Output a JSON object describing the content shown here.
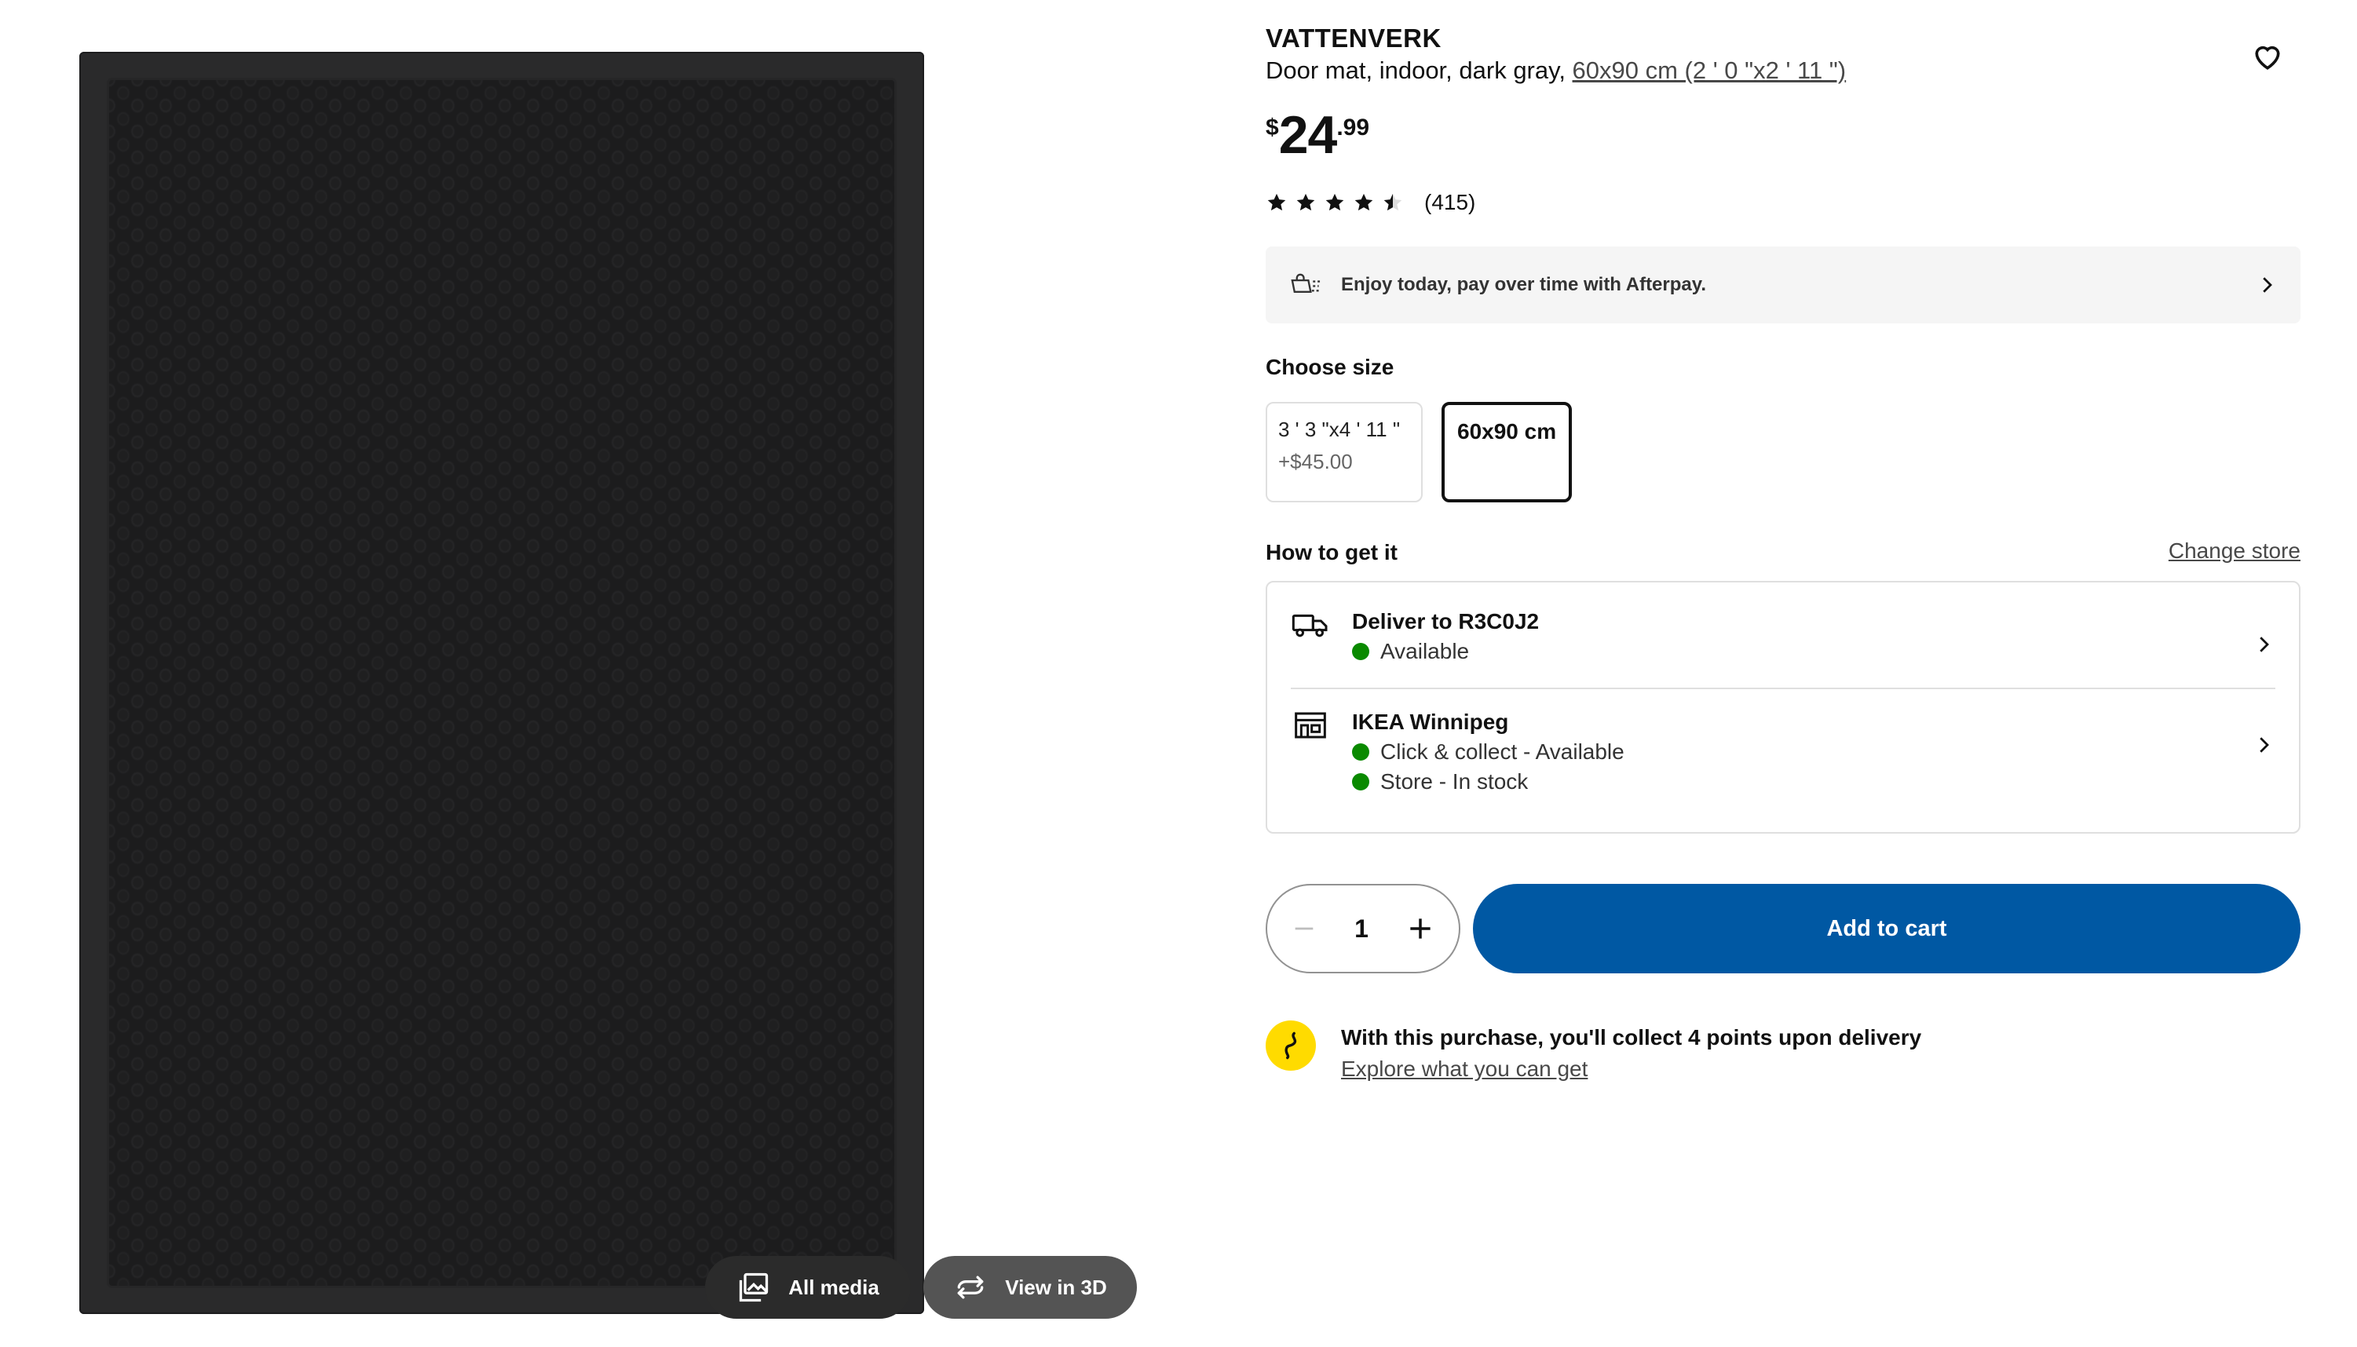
{
  "media": {
    "all_media_label": "All media",
    "view_3d_label": "View in 3D"
  },
  "product": {
    "brand": "VATTENVERK",
    "description": "Door mat, indoor, dark gray, ",
    "size_link": "60x90 cm (2 ' 0 \"x2 ' 11 \")",
    "price_currency": "$",
    "price_whole": "24",
    "price_cents": ".99",
    "rating_value": 4.5,
    "review_count": "(415)"
  },
  "afterpay": {
    "text": "Enjoy today, pay over time with Afterpay."
  },
  "size": {
    "heading": "Choose size",
    "options": [
      {
        "label": "3 ' 3 \"x4 ' 11 \"",
        "extra": "+$45.00",
        "selected": false
      },
      {
        "label": "60x90 cm",
        "extra": "",
        "selected": true
      }
    ]
  },
  "delivery": {
    "heading": "How to get it",
    "change_store": "Change store",
    "deliver_title": "Deliver to R3C0J2",
    "deliver_status": "Available",
    "store_title": "IKEA Winnipeg",
    "store_status_1": "Click & collect - Available",
    "store_status_2": "Store - In stock",
    "status_color": "#0a8a00"
  },
  "purchase": {
    "quantity": "1",
    "add_to_cart": "Add to cart",
    "button_color": "#0058a3"
  },
  "points": {
    "text": "With this purchase, you'll collect 4 points upon delivery",
    "link": "Explore what you can get"
  }
}
